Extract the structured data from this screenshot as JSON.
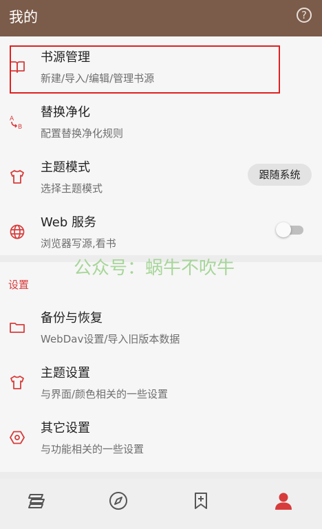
{
  "header": {
    "title": "我的",
    "help_glyph": "?"
  },
  "items": [
    {
      "title": "书源管理",
      "subtitle": "新建/导入/编辑/管理书源",
      "icon": "book-open-icon"
    },
    {
      "title": "替换净化",
      "subtitle": "配置替换净化规则",
      "icon": "replace-ab-icon"
    },
    {
      "title": "主题模式",
      "subtitle": "选择主题模式",
      "icon": "shirt-icon",
      "chip": "跟随系统"
    },
    {
      "title": "Web 服务",
      "subtitle": "浏览器写源,看书",
      "icon": "globe-icon",
      "toggle_on": false
    },
    {
      "title": "备份与恢复",
      "subtitle": "WebDav设置/导入旧版本数据",
      "icon": "folder-icon"
    },
    {
      "title": "主题设置",
      "subtitle": "与界面/颜色相关的一些设置",
      "icon": "shirt-icon"
    },
    {
      "title": "其它设置",
      "subtitle": "与功能相关的一些设置",
      "icon": "hexagon-icon"
    }
  ],
  "section_label": "设置",
  "watermark": "公众号：蜗牛不吹牛",
  "bottom_nav": [
    {
      "name": "bookshelf-icon",
      "active": false
    },
    {
      "name": "compass-icon",
      "active": false
    },
    {
      "name": "bookmark-add-icon",
      "active": false
    },
    {
      "name": "person-icon",
      "active": true
    }
  ],
  "colors": {
    "header_bg": "#7b5b4a",
    "accent": "#d83b3b",
    "highlight_border": "#e02020",
    "watermark": "#9fd38f"
  }
}
